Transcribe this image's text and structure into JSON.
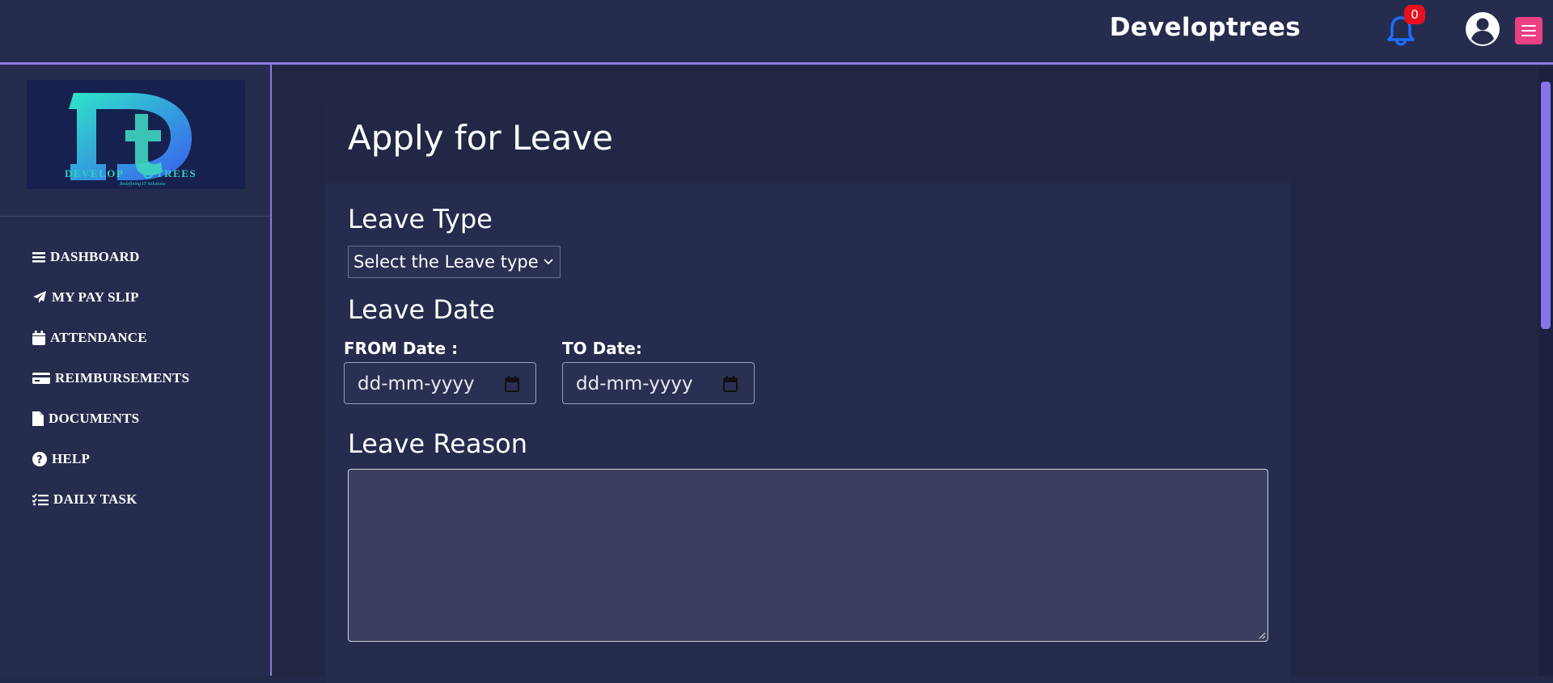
{
  "topbar": {
    "brand": "Developtrees",
    "notification_count": "0",
    "icons": [
      "bell-icon",
      "user-circle-icon",
      "hamburger-menu-icon"
    ]
  },
  "sidebar": {
    "logo": {
      "letters": "Dt",
      "wordmark": "DEVELOPTREES",
      "tagline": "Redefining IT Solutions"
    },
    "items": [
      {
        "label": "DASHBOARD",
        "icon": "bars-icon"
      },
      {
        "label": "MY PAY SLIP",
        "icon": "paper-plane-icon"
      },
      {
        "label": "ATTENDANCE",
        "icon": "calendar-icon"
      },
      {
        "label": "REIMBURSEMENTS",
        "icon": "credit-card-icon"
      },
      {
        "label": "DOCUMENTS",
        "icon": "file-icon"
      },
      {
        "label": "HELP",
        "icon": "question-circle-icon"
      },
      {
        "label": "DAILY TASK",
        "icon": "list-check-icon"
      }
    ]
  },
  "form": {
    "title": "Apply for Leave",
    "leave_type": {
      "label": "Leave Type",
      "selected": "Select the Leave type"
    },
    "leave_date": {
      "label": "Leave Date",
      "from_label": "FROM Date :",
      "to_label": "TO Date:",
      "from_placeholder": "dd-mm-yyyy",
      "to_placeholder": "dd-mm-yyyy"
    },
    "leave_reason": {
      "label": "Leave Reason",
      "value": ""
    }
  },
  "colors": {
    "background": "#232949",
    "accent": "#8b7be6",
    "menu_button": "#e93f83",
    "bell": "#1f6dfc",
    "badge": "#e8101f"
  }
}
